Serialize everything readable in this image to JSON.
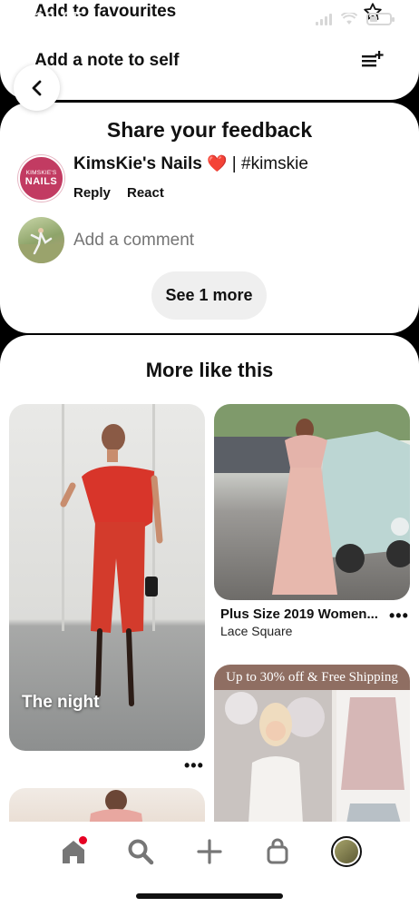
{
  "status_bar": {
    "time": "13:05",
    "back_label": "◂ Search"
  },
  "top_menu": {
    "favourites_label": "Add to favourites",
    "note_label": "Add a note to self"
  },
  "feedback": {
    "title": "Share your feedback",
    "avatar_line1": "KIMSKIE'S",
    "avatar_line2": "NAILS",
    "author": "KimsKie's Nails",
    "heart": "❤️",
    "comment_rest": " | #kimskie",
    "reply_label": "Reply",
    "react_label": "React",
    "add_comment_placeholder": "Add a comment",
    "see_more_label": "See 1 more"
  },
  "more_like_this": {
    "title": "More like this",
    "pins": [
      {
        "caption": "The night"
      },
      {
        "title": "Plus Size 2019 Women...",
        "subtitle": "Lace Square"
      },
      {
        "banner": "Up to 30% off & Free Shipping"
      }
    ],
    "more_glyph": "•••"
  },
  "bottom_nav": {
    "items": [
      "home-icon",
      "search-icon",
      "plus-icon",
      "bag-icon",
      "profile-avatar"
    ],
    "notification_color": "#e60023"
  }
}
